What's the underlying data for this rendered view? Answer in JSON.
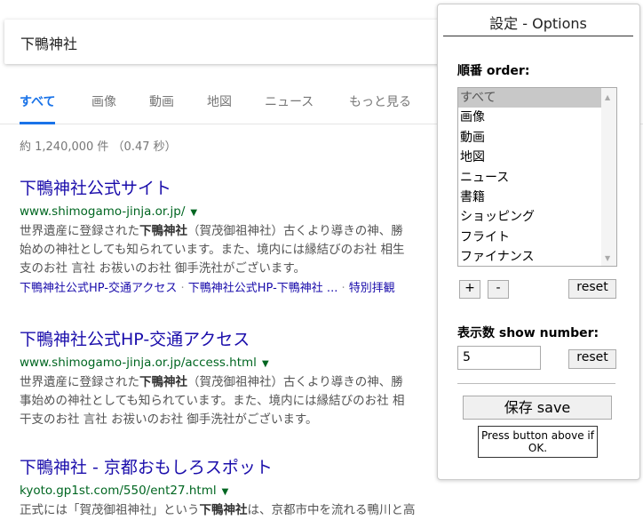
{
  "search": {
    "query": "下鴨神社"
  },
  "tabs": [
    {
      "label": "すべて",
      "active": true
    },
    {
      "label": "画像"
    },
    {
      "label": "動画"
    },
    {
      "label": "地図"
    },
    {
      "label": "ニュース"
    },
    {
      "label": "もっと見る"
    }
  ],
  "stats": "約 1,240,000 件 （0.47 秒）",
  "results": [
    {
      "title": "下鴨神社公式サイト",
      "url": "www.shimogamo-jinja.or.jp/",
      "snippet": [
        "世界遺産に登録された",
        "下鴨神社",
        "（賀茂御祖神社）古くより導きの神、勝",
        "始めの神社としても知られています。また、境内には縁結びのお社 相生",
        "支のお社 言社 お祓いのお社 御手洗社がございます。"
      ],
      "links": [
        "下鴨神社公式HP-交通アクセス",
        "下鴨神社公式HP-下鴨神社 ...",
        "特別拝観"
      ]
    },
    {
      "title": "下鴨神社公式HP-交通アクセス",
      "url": "www.shimogamo-jinja.or.jp/access.html",
      "snippet": [
        "世界遺産に登録された",
        "下鴨神社",
        "（賀茂御祖神社）古くより導きの神、勝",
        "事始めの神社としても知られています。また、境内には縁結びのお社 相",
        "干支のお社 言社 お祓いのお社 御手洗社がございます。"
      ]
    },
    {
      "title": "下鴨神社 - 京都おもしろスポット",
      "url": "kyoto.gp1st.com/550/ent27.html",
      "snippet": [
        "正式には「賀茂御祖神社」という",
        "下鴨神社",
        "は、京都市中を流れる鴨川と高"
      ]
    }
  ],
  "options": {
    "title": "設定 - Options",
    "order_label": "順番 order:",
    "order_items": [
      "すべて",
      "画像",
      "動画",
      "地図",
      "ニュース",
      "書籍",
      "ショッピング",
      "フライト",
      "ファイナンス"
    ],
    "selected": "すべて",
    "plus": "+",
    "minus": "-",
    "reset": "reset",
    "number_label": "表示数 show number:",
    "number_value": "5",
    "save": "保存 save",
    "tooltip": "Press button above if OK."
  }
}
